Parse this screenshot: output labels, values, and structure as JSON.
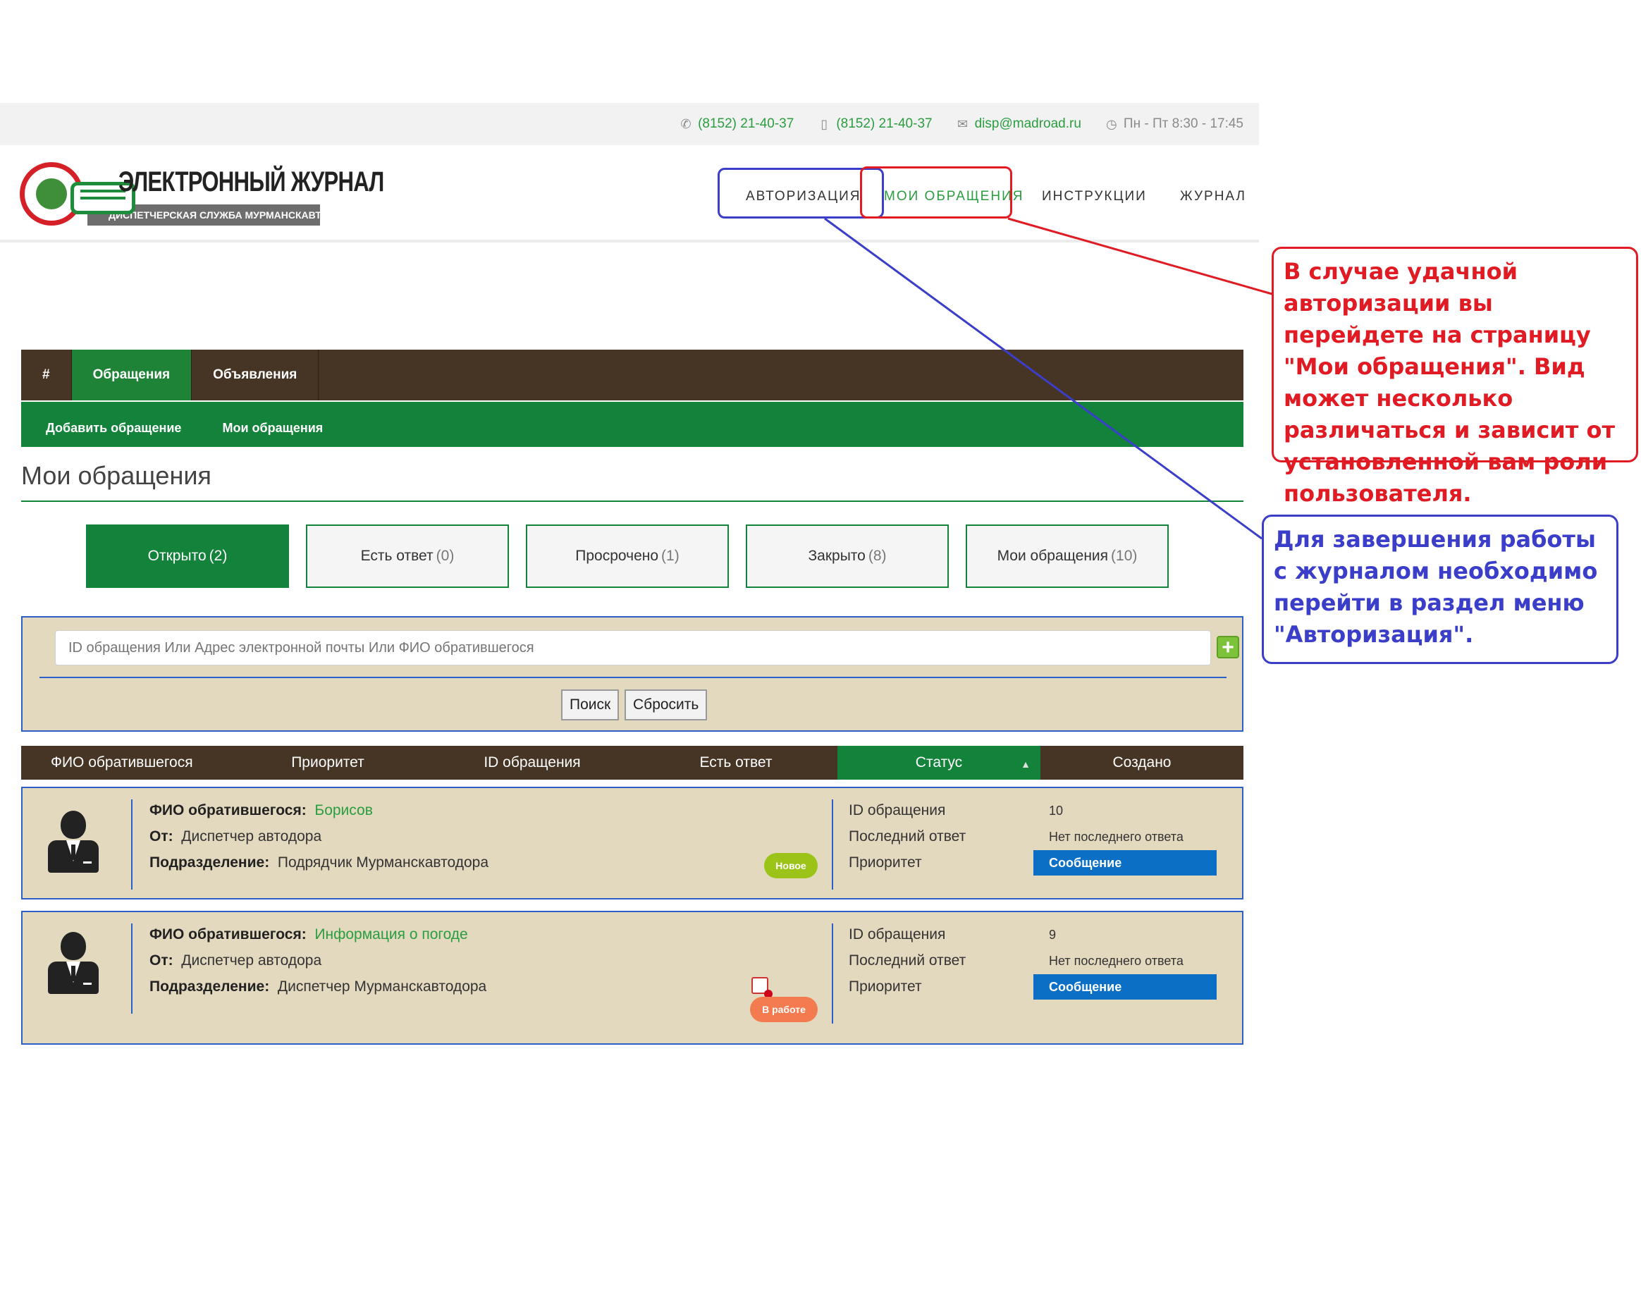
{
  "topbar": {
    "phone": "(8152) 21-40-37",
    "mobile": "(8152) 21-40-37",
    "email": "disp@madroad.ru",
    "hours": "Пн - Пт 8:30 - 17:45",
    "icons": [
      "phone-icon",
      "mobile-icon",
      "envelope-icon",
      "clock-icon"
    ]
  },
  "logo": {
    "title": "ЭЛЕКТРОННЫЙ ЖУРНАЛ",
    "subtitle": "ДИСПЕТЧЕРСКАЯ СЛУЖБА МУРМАНСКАВТОДОРА"
  },
  "nav": {
    "items": [
      {
        "label": "АВТОРИЗАЦИЯ"
      },
      {
        "label": "МОИ ОБРАЩЕНИЯ"
      },
      {
        "label": "ИНСТРУКЦИИ"
      },
      {
        "label": "ЖУРНАЛ"
      }
    ]
  },
  "menu": {
    "primary": [
      {
        "label": "#"
      },
      {
        "label": "Обращения"
      },
      {
        "label": "Объявления"
      }
    ],
    "secondary": [
      {
        "label": "Добавить обращение"
      },
      {
        "label": "Мои обращения"
      }
    ]
  },
  "page": {
    "title": "Мои обращения"
  },
  "tabs": [
    {
      "label": "Открыто",
      "count": "(2)"
    },
    {
      "label": "Есть ответ",
      "count": "(0)"
    },
    {
      "label": "Просрочено",
      "count": "(1)"
    },
    {
      "label": "Закрыто",
      "count": "(8)"
    },
    {
      "label": "Мои обращения",
      "count": "(10)"
    }
  ],
  "search": {
    "placeholder": "ID обращения Или Адрес электронной почты Или ФИО обратившегося",
    "search_label": "Поиск",
    "reset_label": "Сбросить",
    "add_icon": "plus-icon"
  },
  "table": {
    "columns": [
      "ФИО обратившегося",
      "Приоритет",
      "ID обращения",
      "Есть ответ",
      "Статус",
      "Создано"
    ],
    "sorted_column": "Статус",
    "rows": [
      {
        "name_label": "ФИО обратившегося:",
        "name": "Борисов",
        "from_label": "От:",
        "from": "Диспетчер автодора",
        "division_label": "Подразделение:",
        "division": "Подрядчик Мурманскавтодора",
        "status": "Новое",
        "id_label": "ID обращения",
        "id": "10",
        "last_label": "Последний ответ",
        "last": "Нет последнего ответа",
        "priority_label": "Приоритет",
        "priority": "Сообщение"
      },
      {
        "name_label": "ФИО обратившегося:",
        "name": "Информация о погоде",
        "from_label": "От:",
        "from": "Диспетчер автодора",
        "division_label": "Подразделение:",
        "division": "Диспетчер Мурманскавтодора",
        "status": "В работе",
        "id_label": "ID обращения",
        "id": "9",
        "last_label": "Последний ответ",
        "last": "Нет последнего ответа",
        "priority_label": "Приоритет",
        "priority": "Сообщение"
      }
    ]
  },
  "annotations": {
    "red_note": "В случае удачной авторизации вы перейдете на страницу \"Мои обращения\". Вид может несколько различаться и зависит от установленной вам роли пользователя.",
    "blue_note": "Для завершения работы с журналом необходимо перейти в раздел меню \"Авторизация\".",
    "red_color": "#e01b24",
    "blue_color": "#3a3ec9"
  },
  "colors": {
    "brown": "#463424",
    "green": "#13823a",
    "panel": "#e3d9bf",
    "link_green": "#2a9d3f",
    "message_blue": "#0b6fc6",
    "badge_new": "#9cc418",
    "badge_work": "#f47a4f"
  }
}
